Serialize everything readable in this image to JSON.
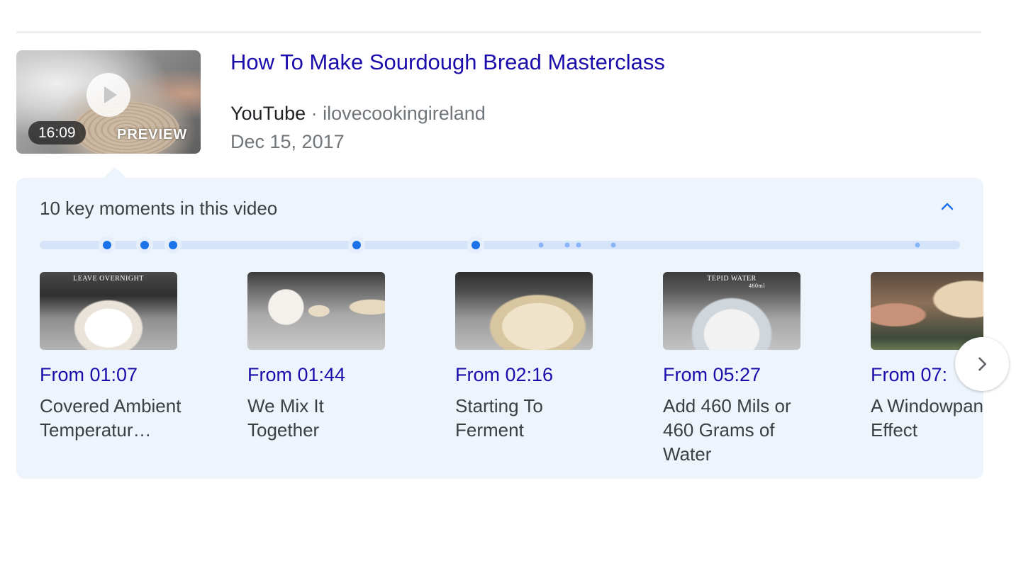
{
  "result": {
    "title": "How To Make Sourdough Bread Masterclass",
    "source": "YouTube",
    "separator": "·",
    "channel": "ilovecookingireland",
    "date": "Dec 15, 2017",
    "thumbnail": {
      "duration": "16:09",
      "preview_label": "PREVIEW",
      "play_icon": "play-icon"
    }
  },
  "key_moments": {
    "heading": "10 key moments in this video",
    "collapse_icon": "chevron-up-icon",
    "next_icon": "chevron-right-icon",
    "items": [
      {
        "time": "From 01:07",
        "description": "Covered Ambient Temperatur…",
        "caption": "LEAVE OVERNIGHT"
      },
      {
        "time": "From 01:44",
        "description": "We Mix It Together"
      },
      {
        "time": "From 02:16",
        "description": "Starting To Ferment"
      },
      {
        "time": "From 05:27",
        "description": "Add 460 Mils or 460 Grams of Water",
        "caption": "TEPID WATER",
        "caption_sub": "460ml"
      },
      {
        "time": "From 07:",
        "description": "A Windowpane Effect"
      }
    ]
  },
  "colors": {
    "link": "#1a0dab",
    "accent": "#1a73e8",
    "panel": "#eef4fc"
  }
}
